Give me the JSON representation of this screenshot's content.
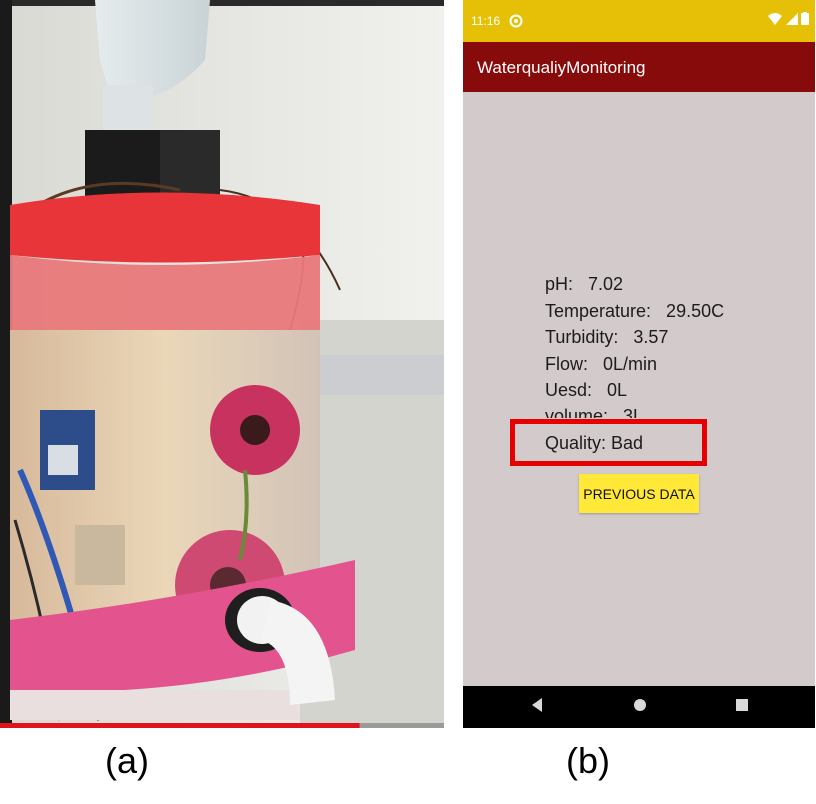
{
  "figure": {
    "panel_a_label": "(a)",
    "panel_b_label": "(b)"
  },
  "phone": {
    "status_bar": {
      "time": "11:16",
      "icons": [
        "settings-icon",
        "wifi-icon",
        "signal-icon",
        "battery-icon"
      ]
    },
    "app_bar": {
      "title": "WaterqualiyMonitoring",
      "color": "#870b0b"
    },
    "readings": [
      {
        "text": "pH:   7.02"
      },
      {
        "text": "Temperature:   29.50C"
      },
      {
        "text": "Turbidity:   3.57"
      },
      {
        "text": "Flow:   0L/min"
      },
      {
        "text": "Uesd:   0L"
      },
      {
        "text": "volume:   3L"
      },
      {
        "text": "Quality: Bad"
      }
    ],
    "highlight_color": "#e60000",
    "button": {
      "label": "PREVIOUS DATA",
      "color": "#ffe838"
    },
    "nav_bar": {
      "icons": [
        "back-icon",
        "home-icon",
        "recents-icon"
      ]
    }
  },
  "photo": {
    "video_progress": 0.81
  }
}
